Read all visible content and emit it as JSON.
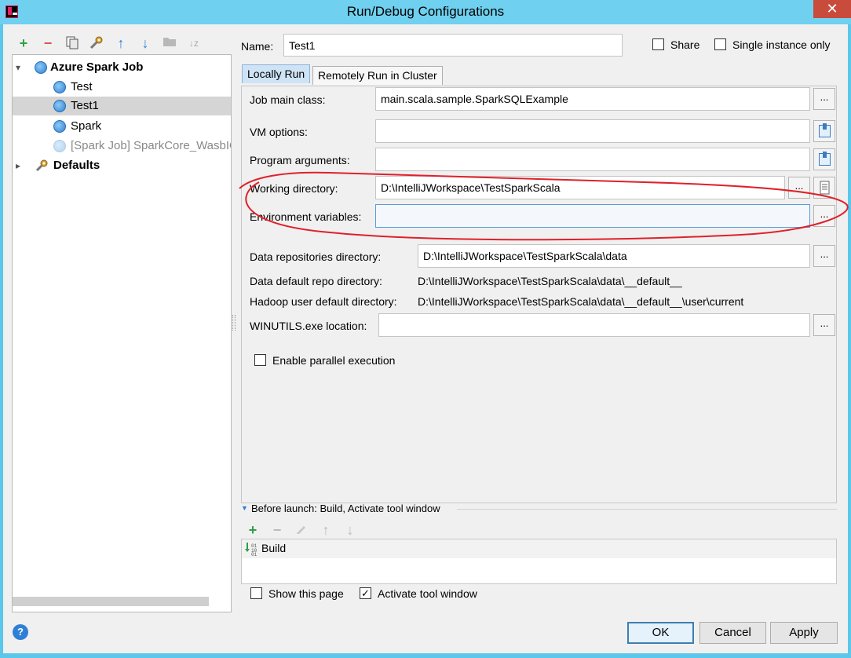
{
  "window": {
    "title": "Run/Debug Configurations",
    "close_glyph": "✕"
  },
  "toolbar": {
    "icons": [
      "add-icon",
      "remove-icon",
      "copy-icon",
      "edit-defaults-icon",
      "move-up-icon",
      "move-down-icon",
      "folder-icon",
      "sort-icon"
    ],
    "add_glyph": "+",
    "remove_glyph": "−",
    "up_glyph": "↑",
    "down_glyph": "↓",
    "sort_glyph": "↓z"
  },
  "tree": {
    "root": {
      "label": "Azure Spark Job"
    },
    "children": [
      {
        "label": "Test"
      },
      {
        "label": "Test1"
      },
      {
        "label": "Spark"
      },
      {
        "label": "[Spark Job] SparkCore_WasbIOTest"
      }
    ],
    "defaults": {
      "label": "Defaults"
    },
    "expand_glyph": "▾",
    "collapse_glyph": "▸"
  },
  "header": {
    "name_label": "Name:",
    "name_value": "Test1",
    "share_label": "Share",
    "single_instance_label": "Single instance only"
  },
  "tabs": [
    {
      "label": "Locally Run",
      "selected": true
    },
    {
      "label": "Remotely Run in Cluster",
      "selected": false
    }
  ],
  "form": {
    "job_main_class": {
      "label": "Job main class:",
      "value": "main.scala.sample.SparkSQLExample"
    },
    "vm_options": {
      "label": "VM options:",
      "value": ""
    },
    "program_arguments": {
      "label": "Program arguments:",
      "value": ""
    },
    "working_directory": {
      "label": "Working directory:",
      "value": "D:\\IntelliJWorkspace\\TestSparkScala"
    },
    "environment_variables": {
      "label": "Environment variables:",
      "value": ""
    },
    "data_repositories_directory": {
      "label": "Data repositories directory:",
      "value": "D:\\IntelliJWorkspace\\TestSparkScala\\data"
    },
    "data_default_repo_directory": {
      "label": "Data default repo directory:",
      "value": "D:\\IntelliJWorkspace\\TestSparkScala\\data\\__default__"
    },
    "hadoop_user_default_directory": {
      "label": "Hadoop user default directory:",
      "value": "D:\\IntelliJWorkspace\\TestSparkScala\\data\\__default__\\user\\current"
    },
    "winutils_location": {
      "label": "WINUTILS.exe location:",
      "value": ""
    },
    "enable_parallel_execution": {
      "label": "Enable parallel execution",
      "checked": false
    },
    "browse_label": "..."
  },
  "before_launch": {
    "title": "Before launch: Build, Activate tool window",
    "items": [
      {
        "label": "Build"
      }
    ]
  },
  "footer": {
    "show_this_page": {
      "label": "Show this page",
      "checked": false
    },
    "activate_tool_window": {
      "label": "Activate tool window",
      "checked": true,
      "check_glyph": "✓"
    },
    "ok_label": "OK",
    "cancel_label": "Cancel",
    "apply_label": "Apply",
    "help_glyph": "?"
  },
  "colors": {
    "annotation": "#e0202a",
    "accent": "#3c7fb1",
    "add_green": "#2ea043",
    "remove_red": "#d9534f"
  }
}
